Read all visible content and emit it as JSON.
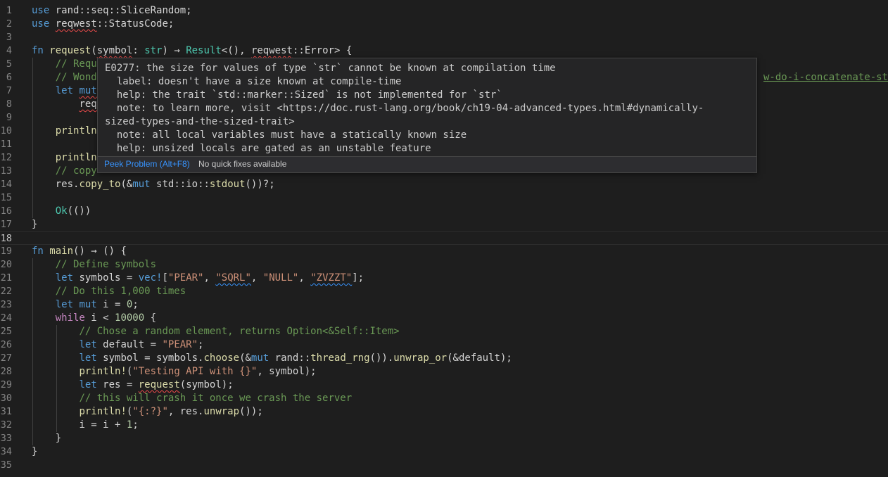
{
  "editor": {
    "line_numbers": [
      "1",
      "2",
      "3",
      "4",
      "5",
      "6",
      "7",
      "8",
      "9",
      "10",
      "11",
      "12",
      "13",
      "14",
      "15",
      "16",
      "17",
      "18",
      "19",
      "20",
      "21",
      "22",
      "23",
      "24",
      "25",
      "26",
      "27",
      "28",
      "29",
      "30",
      "31",
      "32",
      "33",
      "34",
      "35"
    ],
    "lines": [
      [
        {
          "t": "use ",
          "c": "kw"
        },
        {
          "t": "rand",
          "c": "pl"
        },
        {
          "t": "::",
          "c": "pl"
        },
        {
          "t": "seq",
          "c": "pl"
        },
        {
          "t": "::",
          "c": "pl"
        },
        {
          "t": "SliceRandom",
          "c": "pl"
        },
        {
          "t": ";",
          "c": "pl"
        }
      ],
      [
        {
          "t": "use ",
          "c": "kw"
        },
        {
          "t": "reqwest",
          "c": "pl",
          "u": "err"
        },
        {
          "t": "::",
          "c": "pl"
        },
        {
          "t": "StatusCode",
          "c": "pl"
        },
        {
          "t": ";",
          "c": "pl"
        }
      ],
      [],
      [
        {
          "t": "fn ",
          "c": "kw"
        },
        {
          "t": "request",
          "c": "fn"
        },
        {
          "t": "(",
          "c": "pl"
        },
        {
          "t": "symbol",
          "c": "pl",
          "u": "err"
        },
        {
          "t": ": ",
          "c": "pl"
        },
        {
          "t": "str",
          "c": "ty"
        },
        {
          "t": ") → ",
          "c": "pl"
        },
        {
          "t": "Result",
          "c": "ty"
        },
        {
          "t": "<(), ",
          "c": "pl"
        },
        {
          "t": "reqwest",
          "c": "pl",
          "u": "err"
        },
        {
          "t": "::",
          "c": "pl"
        },
        {
          "t": "Error",
          "c": "pl"
        },
        {
          "t": "> {",
          "c": "pl"
        }
      ],
      [
        {
          "t": "    ",
          "c": "pl"
        },
        {
          "t": "// Requ",
          "c": "cm"
        }
      ],
      [
        {
          "t": "    ",
          "c": "pl"
        },
        {
          "t": "// Wond",
          "c": "cm"
        }
      ],
      [
        {
          "t": "    ",
          "c": "pl"
        },
        {
          "t": "let ",
          "c": "kw"
        },
        {
          "t": "mut",
          "c": "kw",
          "u": "err"
        }
      ],
      [
        {
          "t": "        ",
          "c": "pl"
        },
        {
          "t": "requ",
          "c": "pl",
          "u": "err"
        }
      ],
      [],
      [
        {
          "t": "    ",
          "c": "pl"
        },
        {
          "t": "println",
          "c": "fn"
        }
      ],
      [],
      [
        {
          "t": "    ",
          "c": "pl"
        },
        {
          "t": "println",
          "c": "fn"
        }
      ],
      [
        {
          "t": "    ",
          "c": "pl"
        },
        {
          "t": "// copy",
          "c": "cm"
        }
      ],
      [
        {
          "t": "    ",
          "c": "pl"
        },
        {
          "t": "res",
          "c": "pl"
        },
        {
          "t": ".",
          "c": "pl"
        },
        {
          "t": "copy_to",
          "c": "fn"
        },
        {
          "t": "(&",
          "c": "pl"
        },
        {
          "t": "mut ",
          "c": "kw"
        },
        {
          "t": "std",
          "c": "pl"
        },
        {
          "t": "::",
          "c": "pl"
        },
        {
          "t": "io",
          "c": "pl"
        },
        {
          "t": "::",
          "c": "pl"
        },
        {
          "t": "stdout",
          "c": "fn"
        },
        {
          "t": "())?;",
          "c": "pl"
        }
      ],
      [],
      [
        {
          "t": "    ",
          "c": "pl"
        },
        {
          "t": "Ok",
          "c": "ty"
        },
        {
          "t": "(())",
          "c": "pl"
        }
      ],
      [
        {
          "t": "}",
          "c": "pl"
        }
      ],
      [],
      [
        {
          "t": "fn ",
          "c": "kw"
        },
        {
          "t": "main",
          "c": "fn"
        },
        {
          "t": "() → () {",
          "c": "pl"
        }
      ],
      [
        {
          "t": "    ",
          "c": "pl"
        },
        {
          "t": "// Define symbols",
          "c": "cm"
        }
      ],
      [
        {
          "t": "    ",
          "c": "pl"
        },
        {
          "t": "let ",
          "c": "kw"
        },
        {
          "t": "symbols",
          "c": "pl"
        },
        {
          "t": " = ",
          "c": "pl"
        },
        {
          "t": "vec!",
          "c": "mac"
        },
        {
          "t": "[",
          "c": "pl"
        },
        {
          "t": "\"PEAR\"",
          "c": "str"
        },
        {
          "t": ", ",
          "c": "pl"
        },
        {
          "t": "\"SQRL\"",
          "c": "str",
          "u": "warn"
        },
        {
          "t": ", ",
          "c": "pl"
        },
        {
          "t": "\"NULL\"",
          "c": "str"
        },
        {
          "t": ", ",
          "c": "pl"
        },
        {
          "t": "\"ZVZZT\"",
          "c": "str",
          "u": "warn"
        },
        {
          "t": "];",
          "c": "pl"
        }
      ],
      [
        {
          "t": "    ",
          "c": "pl"
        },
        {
          "t": "// Do this 1,000 times",
          "c": "cm"
        }
      ],
      [
        {
          "t": "    ",
          "c": "pl"
        },
        {
          "t": "let ",
          "c": "kw"
        },
        {
          "t": "mut ",
          "c": "kw"
        },
        {
          "t": "i",
          "c": "pl"
        },
        {
          "t": " = ",
          "c": "pl"
        },
        {
          "t": "0",
          "c": "num"
        },
        {
          "t": ";",
          "c": "pl"
        }
      ],
      [
        {
          "t": "    ",
          "c": "pl"
        },
        {
          "t": "while ",
          "c": "ctl"
        },
        {
          "t": "i < ",
          "c": "pl"
        },
        {
          "t": "10000",
          "c": "num"
        },
        {
          "t": " {",
          "c": "pl"
        }
      ],
      [
        {
          "t": "        ",
          "c": "pl"
        },
        {
          "t": "// Chose a random element, returns Option<&Self::Item>",
          "c": "cm"
        }
      ],
      [
        {
          "t": "        ",
          "c": "pl"
        },
        {
          "t": "let ",
          "c": "kw"
        },
        {
          "t": "default",
          "c": "pl"
        },
        {
          "t": " = ",
          "c": "pl"
        },
        {
          "t": "\"PEAR\"",
          "c": "str"
        },
        {
          "t": ";",
          "c": "pl"
        }
      ],
      [
        {
          "t": "        ",
          "c": "pl"
        },
        {
          "t": "let ",
          "c": "kw"
        },
        {
          "t": "symbol",
          "c": "pl"
        },
        {
          "t": " = ",
          "c": "pl"
        },
        {
          "t": "symbols",
          "c": "pl"
        },
        {
          "t": ".",
          "c": "pl"
        },
        {
          "t": "choose",
          "c": "fn"
        },
        {
          "t": "(&",
          "c": "pl"
        },
        {
          "t": "mut ",
          "c": "kw"
        },
        {
          "t": "rand",
          "c": "pl"
        },
        {
          "t": "::",
          "c": "pl"
        },
        {
          "t": "thread_rng",
          "c": "fn"
        },
        {
          "t": "()).",
          "c": "pl"
        },
        {
          "t": "unwrap_or",
          "c": "fn"
        },
        {
          "t": "(&default);",
          "c": "pl"
        }
      ],
      [
        {
          "t": "        ",
          "c": "pl"
        },
        {
          "t": "println!",
          "c": "fn"
        },
        {
          "t": "(",
          "c": "pl"
        },
        {
          "t": "\"Testing API with {}\"",
          "c": "str"
        },
        {
          "t": ", symbol);",
          "c": "pl"
        }
      ],
      [
        {
          "t": "        ",
          "c": "pl"
        },
        {
          "t": "let ",
          "c": "kw"
        },
        {
          "t": "res",
          "c": "pl"
        },
        {
          "t": " = ",
          "c": "pl"
        },
        {
          "t": "request",
          "c": "fn",
          "u": "err"
        },
        {
          "t": "(symbol);",
          "c": "pl"
        }
      ],
      [
        {
          "t": "        ",
          "c": "pl"
        },
        {
          "t": "// this will crash it once we crash the server",
          "c": "cm"
        }
      ],
      [
        {
          "t": "        ",
          "c": "pl"
        },
        {
          "t": "println!",
          "c": "fn"
        },
        {
          "t": "(",
          "c": "pl"
        },
        {
          "t": "\"{:?}\"",
          "c": "str"
        },
        {
          "t": ", res.",
          "c": "pl"
        },
        {
          "t": "unwrap",
          "c": "fn"
        },
        {
          "t": "());",
          "c": "pl"
        }
      ],
      [
        {
          "t": "        ",
          "c": "pl"
        },
        {
          "t": "i = i + ",
          "c": "pl"
        },
        {
          "t": "1",
          "c": "num"
        },
        {
          "t": ";",
          "c": "pl"
        }
      ],
      [
        {
          "t": "    }",
          "c": "pl"
        }
      ],
      [
        {
          "t": "}",
          "c": "pl"
        }
      ],
      []
    ],
    "overflow_link": "w-do-i-concatenate-st"
  },
  "hover": {
    "lines": [
      "E0277: the size for values of type `str` cannot be known at compilation time",
      "  label: doesn't have a size known at compile-time",
      "  help: the trait `std::marker::Sized` is not implemented for `str`",
      "  note: to learn more, visit <https://doc.rust-lang.org/book/ch19-04-advanced-types.html#dynamically-",
      "sized-types-and-the-sized-trait>",
      "  note: all local variables must have a statically known size",
      "  help: unsized locals are gated as an unstable feature"
    ],
    "peek_label": "Peek Problem (Alt+F8)",
    "no_fixes_label": "No quick fixes available"
  }
}
